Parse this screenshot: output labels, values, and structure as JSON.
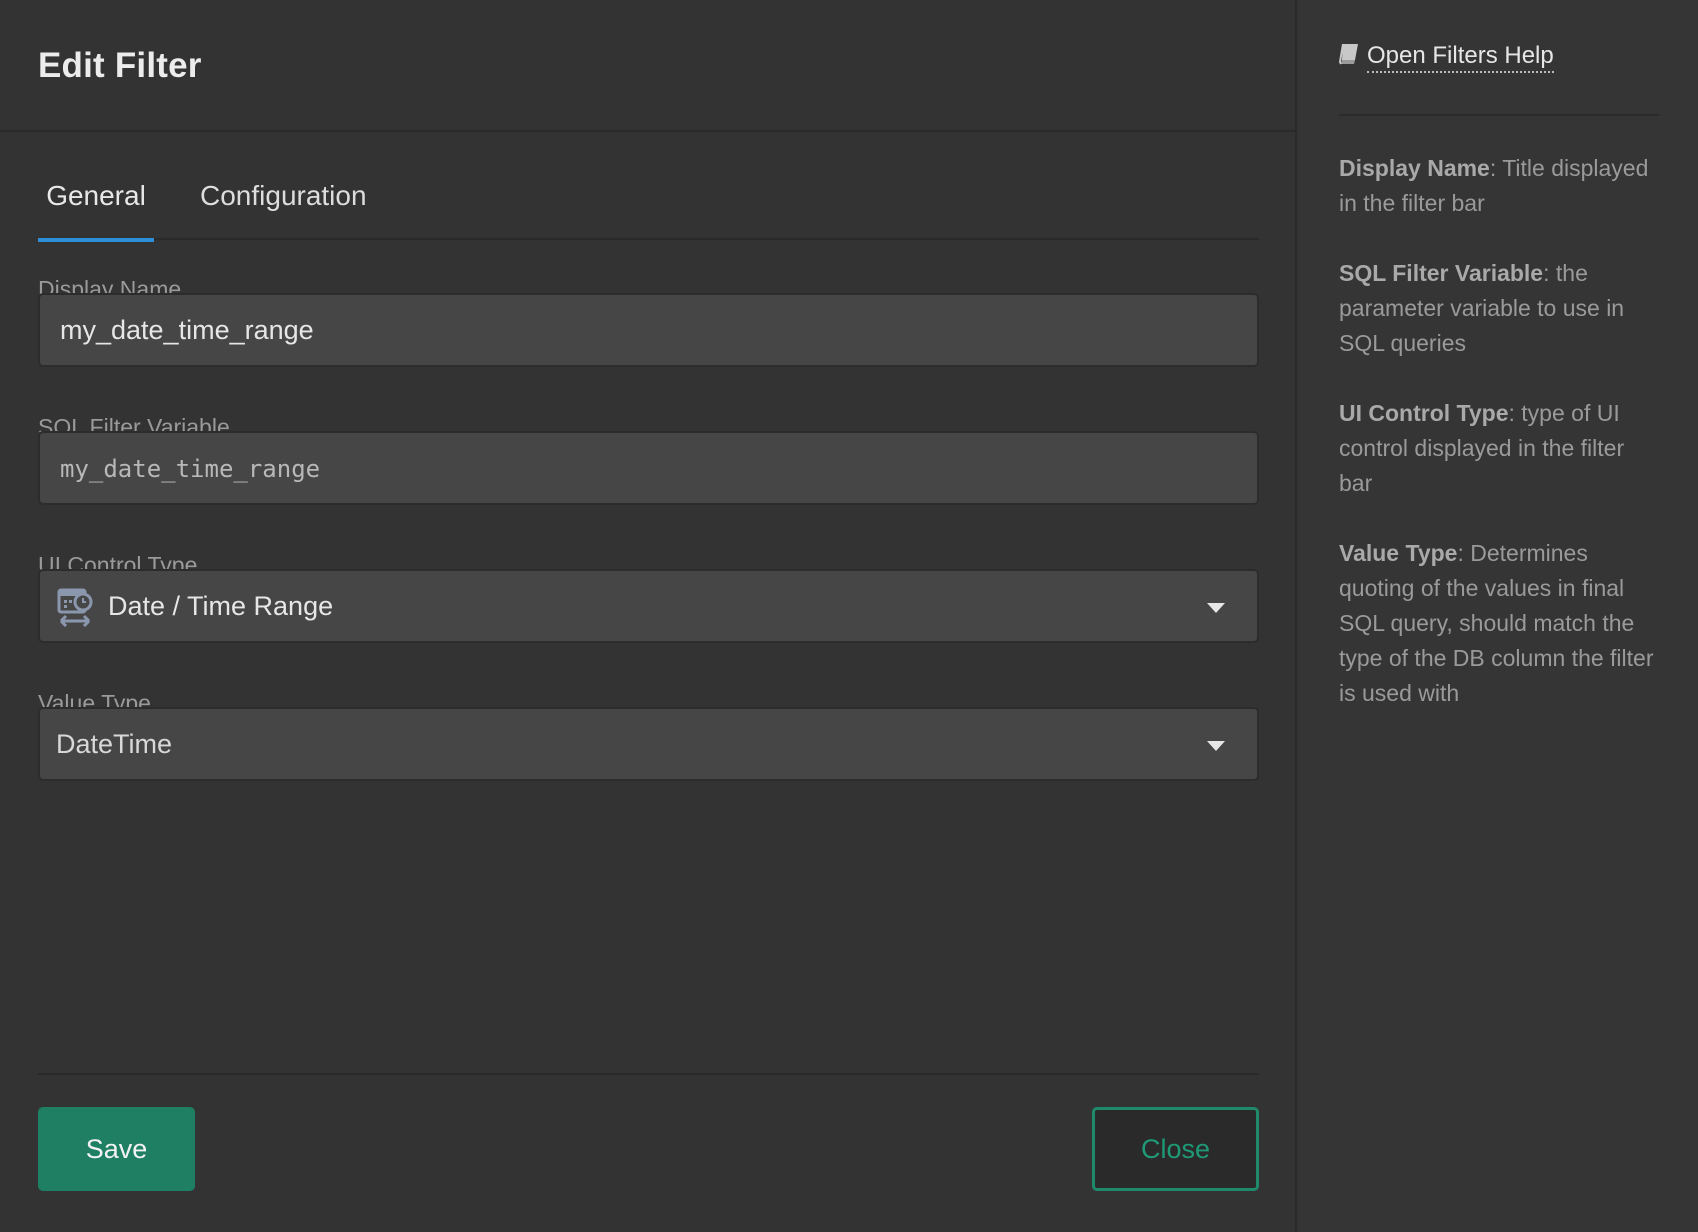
{
  "dialog": {
    "title": "Edit Filter"
  },
  "tabs": [
    {
      "label": "General",
      "active": true
    },
    {
      "label": "Configuration",
      "active": false
    }
  ],
  "fields": {
    "display_name": {
      "label": "Display Name",
      "value": "my_date_time_range"
    },
    "sql_variable": {
      "label": "SQL Filter Variable",
      "value": "my_date_time_range"
    },
    "ui_control_type": {
      "label": "UI Control Type",
      "value": "Date / Time Range",
      "icon": "calendar-clock-range-icon"
    },
    "value_type": {
      "label": "Value Type",
      "value": "DateTime"
    }
  },
  "buttons": {
    "save": "Save",
    "close": "Close"
  },
  "help": {
    "link_label": "Open Filters Help",
    "items": [
      {
        "term": "Display Name",
        "text": ": Title displayed in the filter bar"
      },
      {
        "term": "SQL Filter Variable",
        "text": ": the parameter variable to use in SQL queries"
      },
      {
        "term": "UI Control Type",
        "text": ": type of UI control displayed in the filter bar"
      },
      {
        "term": "Value Type",
        "text": ": Determines quoting of the values in final SQL query, should match the type of the DB column the filter is used with"
      }
    ]
  },
  "colors": {
    "accent_tab": "#2d8fd8",
    "save_bg": "#1f7f63",
    "close_border": "#1f8a6b",
    "background": "#333333"
  }
}
